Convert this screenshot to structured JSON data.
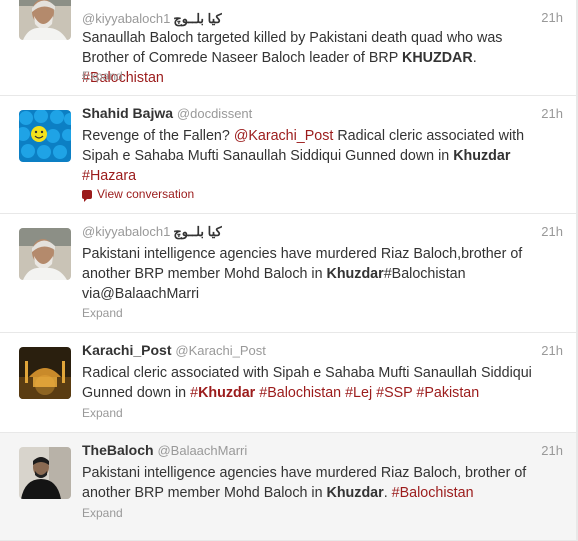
{
  "colors": {
    "link": "#9b1b1b",
    "muted": "#999999",
    "text": "#333333"
  },
  "tweets": [
    {
      "fullname": "",
      "username": "@kiyyabaloch1",
      "urdu_name": "کیا بلــوچ",
      "time": "21h",
      "segments": [
        {
          "t": "Sanaullah Baloch targeted killed by Pakistani death quad who was Brother of Comrede Naseer Baloch leader of BRP "
        },
        {
          "t": "KHUZDAR",
          "b": true
        },
        {
          "t": ". "
        },
        {
          "t": "#Balochistan",
          "l": true
        }
      ],
      "action": "Expand",
      "avatar_icon": "man-grey-beard-avatar"
    },
    {
      "fullname": "Shahid Bajwa",
      "username": "@docdissent",
      "urdu_name": "",
      "time": "21h",
      "segments": [
        {
          "t": "Revenge of the Fallen? "
        },
        {
          "t": "@Karachi_Post",
          "l": true
        },
        {
          "t": " Radical cleric associated with Sipah e Sahaba Mufti Sanaullah Siddiqui Gunned down in "
        },
        {
          "t": "Khuzdar",
          "b": true
        },
        {
          "t": " "
        },
        {
          "t": "#Hazara",
          "l": true
        }
      ],
      "action": "View conversation",
      "avatar_icon": "blue-smiley-balls-avatar"
    },
    {
      "fullname": "",
      "username": "@kiyyabaloch1",
      "urdu_name": "کیا بلــوچ",
      "time": "21h",
      "segments": [
        {
          "t": "Pakistani intelligence agencies have murdered Riaz Baloch,brother of another BRP member Mohd Baloch in "
        },
        {
          "t": "Khuzdar",
          "b": true
        },
        {
          "t": "#Balochistan via@BalaachMarri"
        }
      ],
      "action": "Expand",
      "avatar_icon": "man-grey-beard-avatar"
    },
    {
      "fullname": "Karachi_Post",
      "username": "@Karachi_Post",
      "urdu_name": "",
      "time": "21h",
      "segments": [
        {
          "t": "Radical cleric associated with Sipah e Sahaba Mufti Sanaullah Siddiqui Gunned down in "
        },
        {
          "t": "#",
          "l": true
        },
        {
          "t": "Khuzdar",
          "l": true,
          "b": true
        },
        {
          "t": " "
        },
        {
          "t": "#Balochistan",
          "l": true
        },
        {
          "t": " "
        },
        {
          "t": "#Lej",
          "l": true
        },
        {
          "t": " "
        },
        {
          "t": "#SSP",
          "l": true
        },
        {
          "t": " "
        },
        {
          "t": "#Pakistan",
          "l": true
        }
      ],
      "action": "Expand",
      "avatar_icon": "night-mosque-avatar"
    },
    {
      "fullname": "TheBaloch",
      "username": "@BalaachMarri",
      "urdu_name": "",
      "time": "21h",
      "segments": [
        {
          "t": "Pakistani intelligence agencies have murdered Riaz Baloch, brother of another BRP member Mohd Baloch in "
        },
        {
          "t": "Khuzdar",
          "b": true
        },
        {
          "t": ". "
        },
        {
          "t": "#Balochistan",
          "l": true
        }
      ],
      "action": "Expand",
      "avatar_icon": "man-dark-portrait-avatar"
    }
  ]
}
